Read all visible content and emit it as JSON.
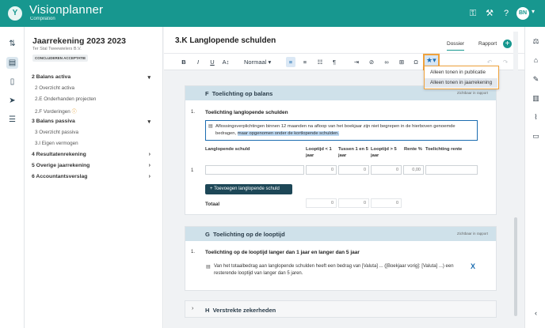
{
  "app": {
    "name": "Visionplanner",
    "subtitle": "Compilation",
    "logo": "Y",
    "user_initials": "BN"
  },
  "icons": {
    "top": [
      "key-icon",
      "tools-icon",
      "help-icon"
    ],
    "rail": [
      "transfer-icon",
      "document-view-icon",
      "page-icon",
      "send-icon",
      "list-icon"
    ],
    "rrail": [
      "scale-icon",
      "bank-icon",
      "wrench-icon",
      "paperclip-icon",
      "message-icon",
      "collapse-icon"
    ]
  },
  "sidebar": {
    "title": "Jaarrekening 2023 2023",
    "client": "Ter Stal Tweewielers B.V.",
    "badge": "CONCLUDEREN ACCEPTATIE",
    "items": [
      {
        "label": "2 Balans activa",
        "type": "group",
        "chev": "▾"
      },
      {
        "label": "2 Overzicht activa",
        "type": "sub"
      },
      {
        "label": "2.E Onderhanden projecten",
        "type": "sub"
      },
      {
        "label": "2.F Vorderingen",
        "type": "sub",
        "warn": "ⓘ"
      },
      {
        "label": "3 Balans passiva",
        "type": "group",
        "chev": "▾"
      },
      {
        "label": "3 Overzicht passiva",
        "type": "sub"
      },
      {
        "label": "3.I Eigen vermogen",
        "type": "sub"
      },
      {
        "label": "4 Resultatenrekening",
        "type": "group",
        "chev": "›"
      },
      {
        "label": "5 Overige jaarrekening",
        "type": "group",
        "chev": "›"
      },
      {
        "label": "6 Accountantsverslag",
        "type": "group",
        "chev": "›"
      }
    ]
  },
  "main": {
    "title": "3.K Langlopende schulden",
    "tabs": [
      "Dossier",
      "Rapport"
    ],
    "add": "+",
    "toolbar": {
      "bold": "B",
      "italic": "I",
      "underline": "U",
      "fontsize": "A↕",
      "style": "Normaal",
      "omega": "Ω"
    },
    "dropdown": [
      "Alleen tonen in publicatie",
      "Alleen tonen in jaarrekening"
    ],
    "hidden_label": "Zichtbaar in rapport"
  },
  "sectionF": {
    "letter": "F",
    "title": "Toelichting op balans",
    "row_num": "1.",
    "row_title": "Toelichting langlopende schulden",
    "note_text": "Aflossingsverplichtingen binnen 12 maanden na afloop van het boekjaar zijn niet begrepen in de hierboven genoemde bedragen,",
    "note_highlight": "maar opgenomen onder de kortlopende schulden.",
    "columns": [
      "Langlopende schuld",
      "Looptijd < 1 jaar",
      "Tussen 1 en 5 jaar",
      "Looptijd > 5 jaar",
      "Rente %",
      "Toelichting rente"
    ],
    "row1_num": "1",
    "row1_values": [
      "0",
      "0",
      "0",
      "0,00"
    ],
    "add_button": "+  Toevoegen langlopende schuld",
    "total_label": "Totaal",
    "total_values": [
      "0",
      "0",
      "0"
    ]
  },
  "sectionG": {
    "letter": "G",
    "title": "Toelichting op de looptijd",
    "right": "Zichtbaar in rapport",
    "row_num": "1.",
    "row_title": "Toelichting op de looptijd langer dan 1 jaar en langer dan 5 jaar",
    "text": "Van het totaalbedrag aan langlopende schulden heeft een bedrag van [Valuta] ... ([Boekjaar vorig]: [Valuta] ...) een resterende looptijd van langer dan 5 jaren.",
    "x": "X"
  },
  "sectionH": {
    "letter": "H",
    "title": "Verstrekte zekerheden",
    "chev": "›"
  }
}
